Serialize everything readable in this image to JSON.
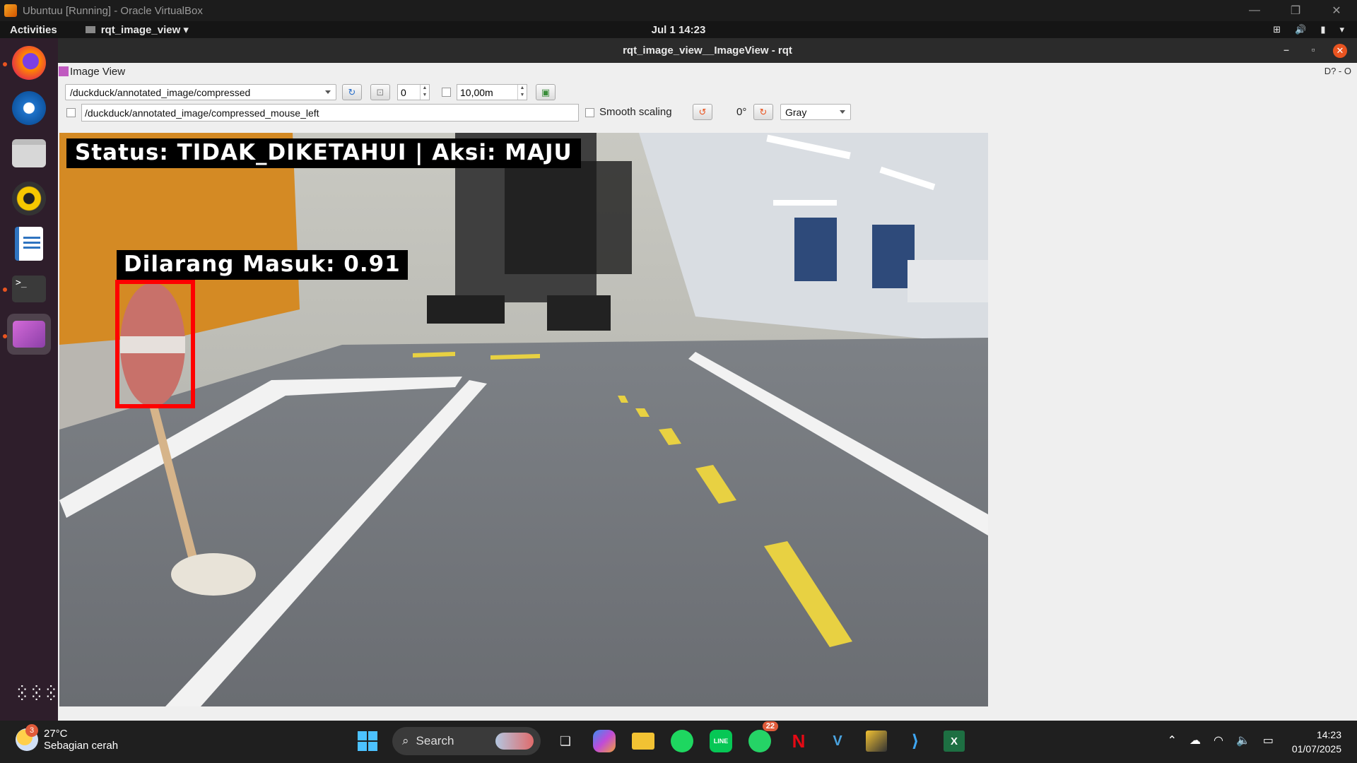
{
  "vbox": {
    "title": "Ubuntuu [Running] - Oracle VirtualBox",
    "minimize": "—",
    "restore": "❐",
    "close": "✕"
  },
  "gnome": {
    "activities": "Activities",
    "app_menu": "rqt_image_view ▾",
    "clock": "Jul 1  14:23",
    "tray": [
      "network-icon",
      "volume-icon",
      "battery-icon",
      "menu-caret-icon"
    ]
  },
  "dock": {
    "items": [
      {
        "name": "firefox",
        "color": "#e66000"
      },
      {
        "name": "thunderbird",
        "color": "#1e72c9"
      },
      {
        "name": "files",
        "color": "#d7d7d7"
      },
      {
        "name": "rhythmbox",
        "color": "#f6c800"
      },
      {
        "name": "libreoffice-writer",
        "color": "#2f74c0"
      },
      {
        "name": "terminal",
        "color": "#3a3a3a"
      },
      {
        "name": "image-viewer",
        "color": "#a74bb3"
      }
    ],
    "apps_grid": "⋮⋮⋮"
  },
  "rqt": {
    "title": "rqt_image_view__ImageView - rqt",
    "plugin_title": "Image View",
    "plugin_tools": "D?  -  O",
    "topic": "/duckduck/annotated_image/compressed",
    "spin_value": "0",
    "rate_value": "10,00m",
    "mouse_topic": "/duckduck/annotated_image/compressed_mouse_left",
    "smooth_scaling": "Smooth scaling",
    "rotation": "0°",
    "colormap": "Gray"
  },
  "image": {
    "status_text": "Status: TIDAK_DIKETAHUI | Aksi: MAJU",
    "detection_label": "Dilarang Masuk: 0.91"
  },
  "taskbar": {
    "temperature": "27°C",
    "weather_desc": "Sebagian cerah",
    "weather_badge": "3",
    "search_label": "Search",
    "whatsapp_badge": "22",
    "time": "14:23",
    "date": "01/07/2025"
  }
}
